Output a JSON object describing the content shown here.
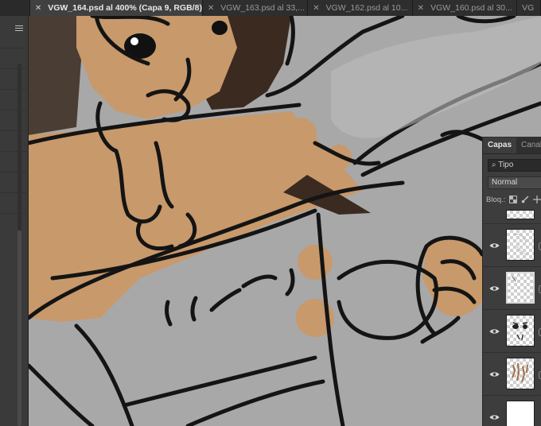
{
  "tabs": [
    {
      "label": "VGW_164.psd al 400% (Capa 9, RGB/8) *",
      "active": true
    },
    {
      "label": "VGW_163.psd al 33,...",
      "active": false
    },
    {
      "label": "VGW_162.psd al 10...",
      "active": false
    },
    {
      "label": "VGW_160.psd al 30...",
      "active": false
    },
    {
      "label": "VG",
      "active": false
    }
  ],
  "layers_panel": {
    "tabs": [
      "Capas",
      "Canale"
    ],
    "filter_label": "Tipo",
    "blend_mode": "Normal",
    "lock_label": "Bloq.:"
  },
  "colors": {
    "canvas_gray": "#a8a8a8",
    "skin": "#c8996b",
    "hair": "#3a2a20",
    "ui_dark": "#3d3d3d"
  },
  "icons": {
    "tab_close": "close-icon",
    "layer_visibility": "eye-icon",
    "filter": "search-icon"
  }
}
